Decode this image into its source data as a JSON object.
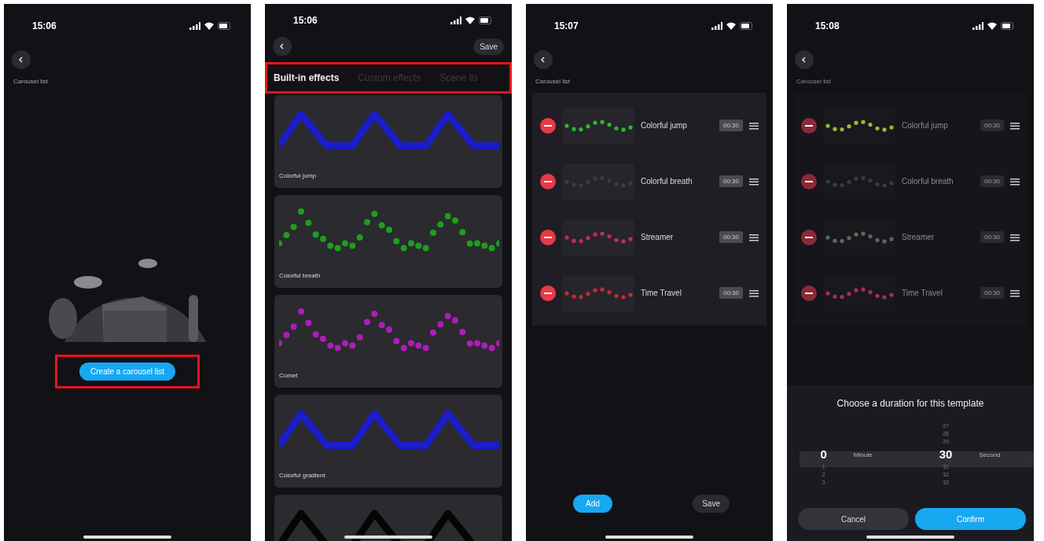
{
  "screens": [
    {
      "kind": "empty",
      "time": "15:06",
      "title": "Carousel list",
      "create_button": {
        "label": "Create a carousel list",
        "highlighted": true
      }
    },
    {
      "kind": "effects",
      "time": "15:06",
      "save": "Save",
      "tabs_highlighted": true,
      "tabs": [
        {
          "label": "Built-in effects",
          "selected": true
        },
        {
          "label": "Custom effects",
          "selected": false
        },
        {
          "label": "Scene lis",
          "selected": false
        }
      ],
      "cards": [
        {
          "name": "Colorful jump",
          "color": "#1c1cc8",
          "kind": "line"
        },
        {
          "name": "Colorful breath",
          "color": "#1e9e1e",
          "kind": "dots"
        },
        {
          "name": "Comet",
          "color": "#b01cb8",
          "kind": "dots"
        },
        {
          "name": "Colorful gradient",
          "color": "#1c1cc8",
          "kind": "line"
        },
        {
          "color": "#050505",
          "kind": "line"
        }
      ]
    },
    {
      "kind": "list",
      "time": "15:07",
      "title": "Carousel list",
      "dimmed": false,
      "add": "Add",
      "save": "Save",
      "rows": [
        {
          "name": "Colorful jump",
          "duration": "00:30",
          "color": "#2eb82e"
        },
        {
          "name": "Colorful breath",
          "duration": "00:30",
          "color": "#3a3a44"
        },
        {
          "name": "Streamer",
          "duration": "00:30",
          "color": "#c0304a"
        },
        {
          "name": "Time Travel",
          "duration": "00:30",
          "color": "#c8283c"
        }
      ]
    },
    {
      "kind": "picker",
      "time": "15:08",
      "title": "Carousel list",
      "dimmed": true,
      "rows": [
        {
          "name": "Colorful jump",
          "duration": "00:30",
          "color": "#9cb82e"
        },
        {
          "name": "Colorful breath",
          "duration": "00:30",
          "color": "#3a3a44"
        },
        {
          "name": "Streamer",
          "duration": "00:30",
          "color": "#5a6a5a"
        },
        {
          "name": "Time Travel",
          "duration": "00:30",
          "color": "#a0305a"
        }
      ],
      "sheet": {
        "title": "Choose a duration for this template",
        "wheels": [
          {
            "value": "0",
            "below": [
              "1",
              "2",
              "3"
            ],
            "unit": "Minute"
          },
          {
            "above": [
              "27",
              "28",
              "29"
            ],
            "value": "30",
            "below": [
              "31",
              "32",
              "33"
            ],
            "unit": "Second"
          }
        ],
        "cancel": "Cancel",
        "confirm": "Confirm"
      }
    }
  ]
}
